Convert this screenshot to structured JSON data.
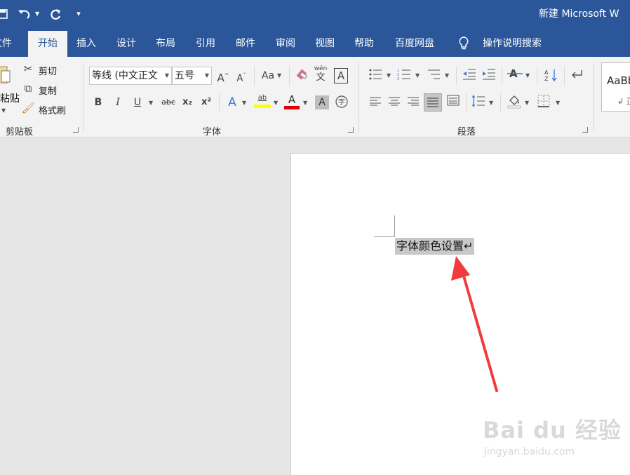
{
  "titlebar": {
    "title": "新建 Microsoft W",
    "quick_access": [
      "save-icon",
      "undo-icon",
      "redo-icon",
      "customize-icon"
    ]
  },
  "tabs": [
    {
      "label": "文件"
    },
    {
      "label": "开始"
    },
    {
      "label": "插入"
    },
    {
      "label": "设计"
    },
    {
      "label": "布局"
    },
    {
      "label": "引用"
    },
    {
      "label": "邮件"
    },
    {
      "label": "审阅"
    },
    {
      "label": "视图"
    },
    {
      "label": "帮助"
    },
    {
      "label": "百度网盘"
    },
    {
      "label": "操作说明搜索"
    }
  ],
  "clipboard": {
    "paste_label": "粘贴",
    "cut_label": "剪切",
    "copy_label": "复制",
    "format_painter_label": "格式刷",
    "group_label": "剪贴板"
  },
  "font": {
    "font_name": "等线 (中文正文",
    "font_size": "五号",
    "group_label": "字体",
    "bold": "B",
    "italic": "I",
    "underline": "U",
    "strike": "abc",
    "subscript": "x₂",
    "superscript": "x²",
    "change_case": "Aa",
    "grow": "A",
    "shrink": "A",
    "phonetic_top": "wén",
    "phonetic_bottom": "文",
    "highlight_letters": "ab",
    "font_color_letter": "A",
    "font_color_hex": "#e00000",
    "highlight_hex": "#ffff00"
  },
  "paragraph": {
    "group_label": "段落"
  },
  "styles": {
    "preview": "AaBb"
  },
  "document": {
    "selected_text": "字体颜色设置↵"
  },
  "watermark": {
    "logo_text": "Bai du 经验",
    "url": "jingyan.baidu.com"
  },
  "colors": {
    "word_blue": "#2b579a",
    "arrow_red": "#f03c3c"
  }
}
